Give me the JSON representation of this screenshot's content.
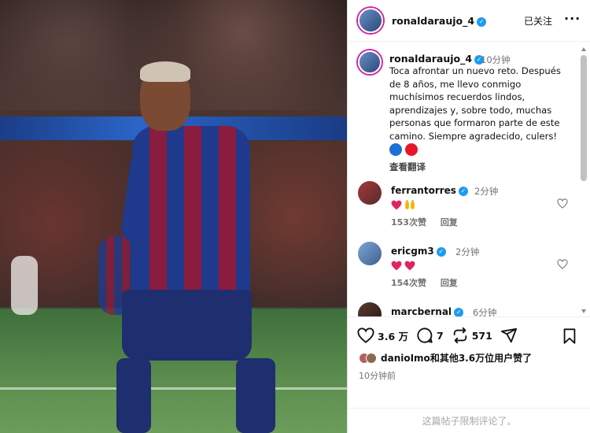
{
  "post": {
    "username": "ronaldaraujo_4",
    "follow_status": "已关注",
    "more": "···",
    "caption_time": "10分钟",
    "caption_text": "Toca afrontar un nuevo reto. Después de 8 años, me llevo conmigo muchísimos recuerdos lindos, aprendizajes y, sobre todo, muchas personas que formaron parte de este camino. Siempre agradecido, culers!",
    "caption_emojis": [
      "blue-circle",
      "red-circle"
    ],
    "translate_label": "查看翻译"
  },
  "colors": {
    "verified": "#1d9bf0",
    "heart_red": "#e0245e",
    "muted": "#737373",
    "story_ring": "#d6249f",
    "blue_circle": "#1d6fd6",
    "red_circle": "#e8162a"
  },
  "comments": [
    {
      "username": "ferrantorres",
      "time": "2分钟",
      "emojis": [
        "red-heart",
        "raised-hands"
      ],
      "likes": "153次赞",
      "reply": "回复"
    },
    {
      "username": "ericgm3",
      "time": "2分钟",
      "emojis": [
        "red-heart",
        "red-heart"
      ],
      "likes": "154次赞",
      "reply": "回复"
    },
    {
      "username": "marcbernal",
      "time": "6分钟"
    }
  ],
  "actions": {
    "likes": "3.6 万",
    "comments": "7",
    "reposts": "571"
  },
  "liked_by": {
    "user": "danиolmo",
    "user_display": "danioImo",
    "rest": "和其他3.6万位用户赞了"
  },
  "posted_ago": "10分钟前",
  "comments_restricted": "这篇帖子限制评论了。"
}
